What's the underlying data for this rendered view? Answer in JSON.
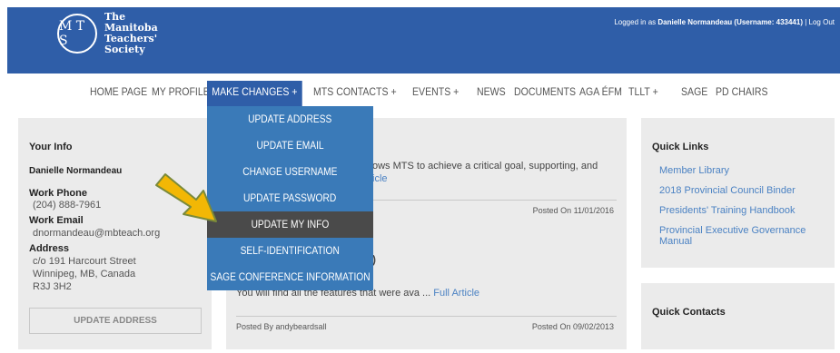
{
  "header": {
    "logo_letters": "M T S",
    "logo_line1": "The",
    "logo_line2": "Manitoba",
    "logo_line3": "Teachers'",
    "logo_line4": "Society",
    "logged_in_prefix": "Logged in as ",
    "user_display": "Danielle Normandeau (Username: 433441)",
    "separator": " | ",
    "logout": "Log Out"
  },
  "nav": {
    "items": [
      {
        "label": "HOME PAGE"
      },
      {
        "label": "MY PROFILE"
      },
      {
        "label": "MAKE CHANGES +"
      },
      {
        "label": "MTS CONTACTS +"
      },
      {
        "label": "EVENTS +"
      },
      {
        "label": "NEWS"
      },
      {
        "label": "DOCUMENTS"
      },
      {
        "label": "AGA ÉFM"
      },
      {
        "label": "TLLT +"
      },
      {
        "label": "SAGE"
      },
      {
        "label": "PD CHAIRS"
      }
    ]
  },
  "dropdown": {
    "items": [
      {
        "label": "UPDATE ADDRESS"
      },
      {
        "label": "UPDATE EMAIL"
      },
      {
        "label": "CHANGE USERNAME"
      },
      {
        "label": "UPDATE PASSWORD"
      },
      {
        "label": "UPDATE MY INFO"
      },
      {
        "label": "SELF-IDENTIFICATION"
      },
      {
        "label": "SAGE CONFERENCE INFORMATION"
      }
    ],
    "highlight_color": "#4a4a4a"
  },
  "your_info": {
    "title": "Your Info",
    "name": "Danielle Normandeau",
    "work_phone_label": "Work Phone",
    "work_phone": "(204) 888-7961",
    "work_email_label": "Work Email",
    "work_email": "dnormandeau@mbteach.org",
    "address_label": "Address",
    "address_line1": "c/o 191 Harcourt Street",
    "address_line2": "Winnipeg, MB, Canada",
    "address_line3": "R3J 3H2",
    "update_button": "UPDATE ADDRESS"
  },
  "center": {
    "article1_snippet": "ows MTS to achieve a critical goal, supporting, and",
    "article1_link_tail": "icle",
    "article1_posted": "Posted On 11/01/2016",
    "article2_title_tail": ")",
    "article2_snippet": "You will find all the features that were ava ... ",
    "article2_link": "Full Article",
    "article2_by": "Posted By andybeardsall",
    "article2_posted": "Posted On 09/02/2013"
  },
  "quick_links": {
    "title": "Quick Links",
    "items": [
      {
        "label": "Member Library"
      },
      {
        "label": "2018 Provincial Council Binder"
      },
      {
        "label": "Presidents' Training Handbook"
      },
      {
        "label": "Provincial Executive Governance Manual"
      }
    ]
  },
  "quick_contacts": {
    "title": "Quick Contacts"
  },
  "colors": {
    "brand_blue": "#2f5ea8",
    "menu_blue": "#3a7ab8",
    "link_blue": "#4b82c3",
    "arrow_yellow": "#f2b705"
  }
}
